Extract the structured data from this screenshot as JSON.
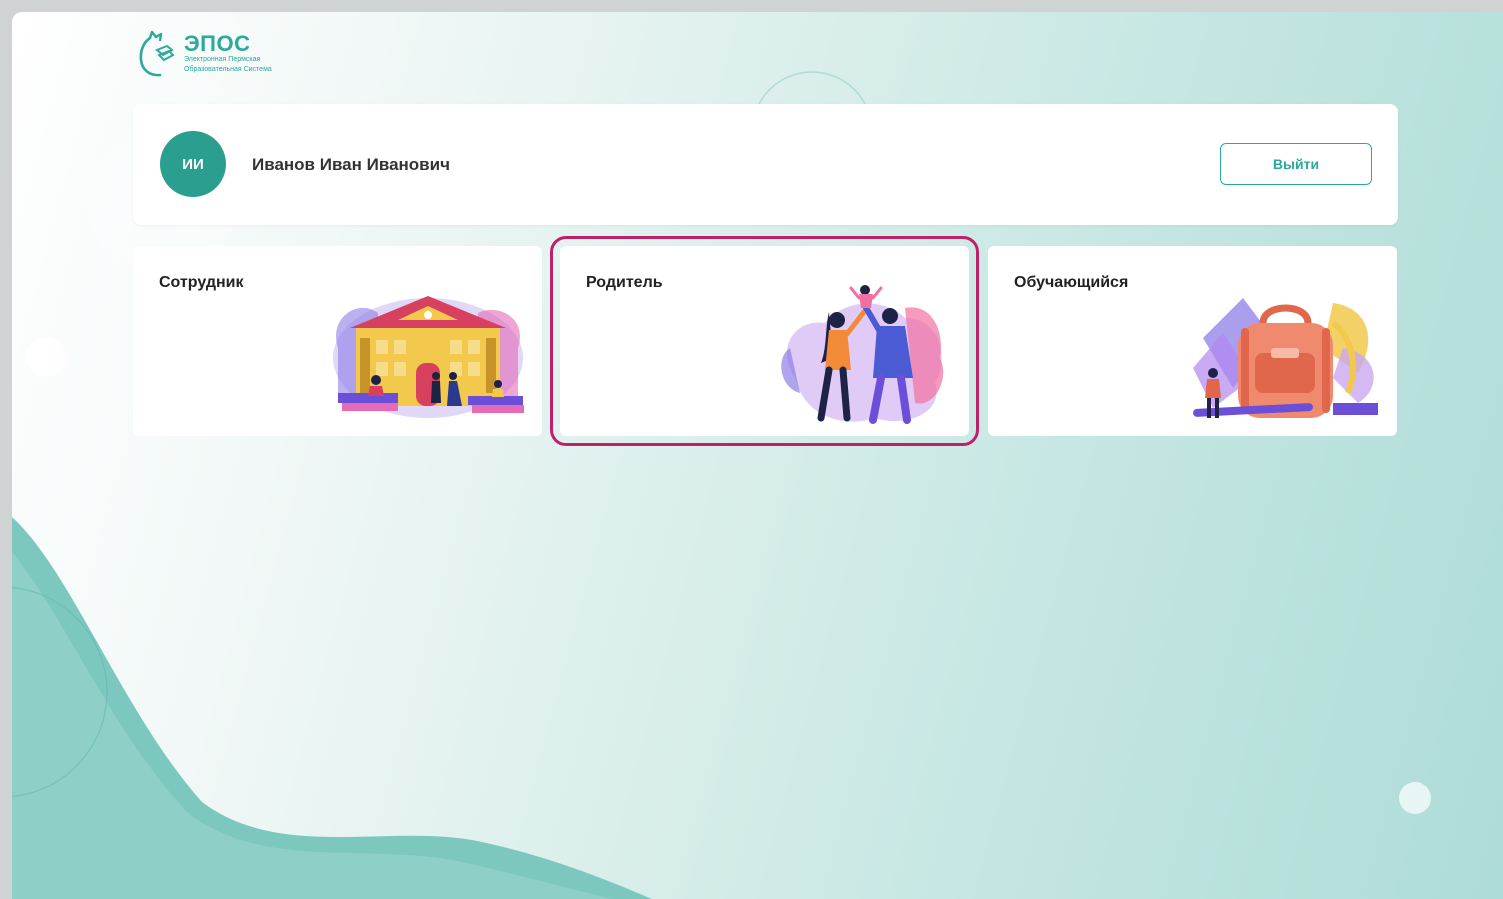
{
  "logo": {
    "title": "ЭПОС",
    "subtitle_line1": "Электронная Пермская",
    "subtitle_line2": "Образовательная Система"
  },
  "user": {
    "initials": "ИИ",
    "full_name": "Иванов Иван Иванович"
  },
  "logout_label": "Выйти",
  "roles": [
    {
      "title": "Сотрудник",
      "icon": "school-building-illustration"
    },
    {
      "title": "Родитель",
      "icon": "family-illustration",
      "selected": true
    },
    {
      "title": "Обучающийся",
      "icon": "backpack-illustration"
    }
  ],
  "colors": {
    "accent": "#2ba99a",
    "avatar": "#2a9f90",
    "selection": "#c0206a"
  }
}
